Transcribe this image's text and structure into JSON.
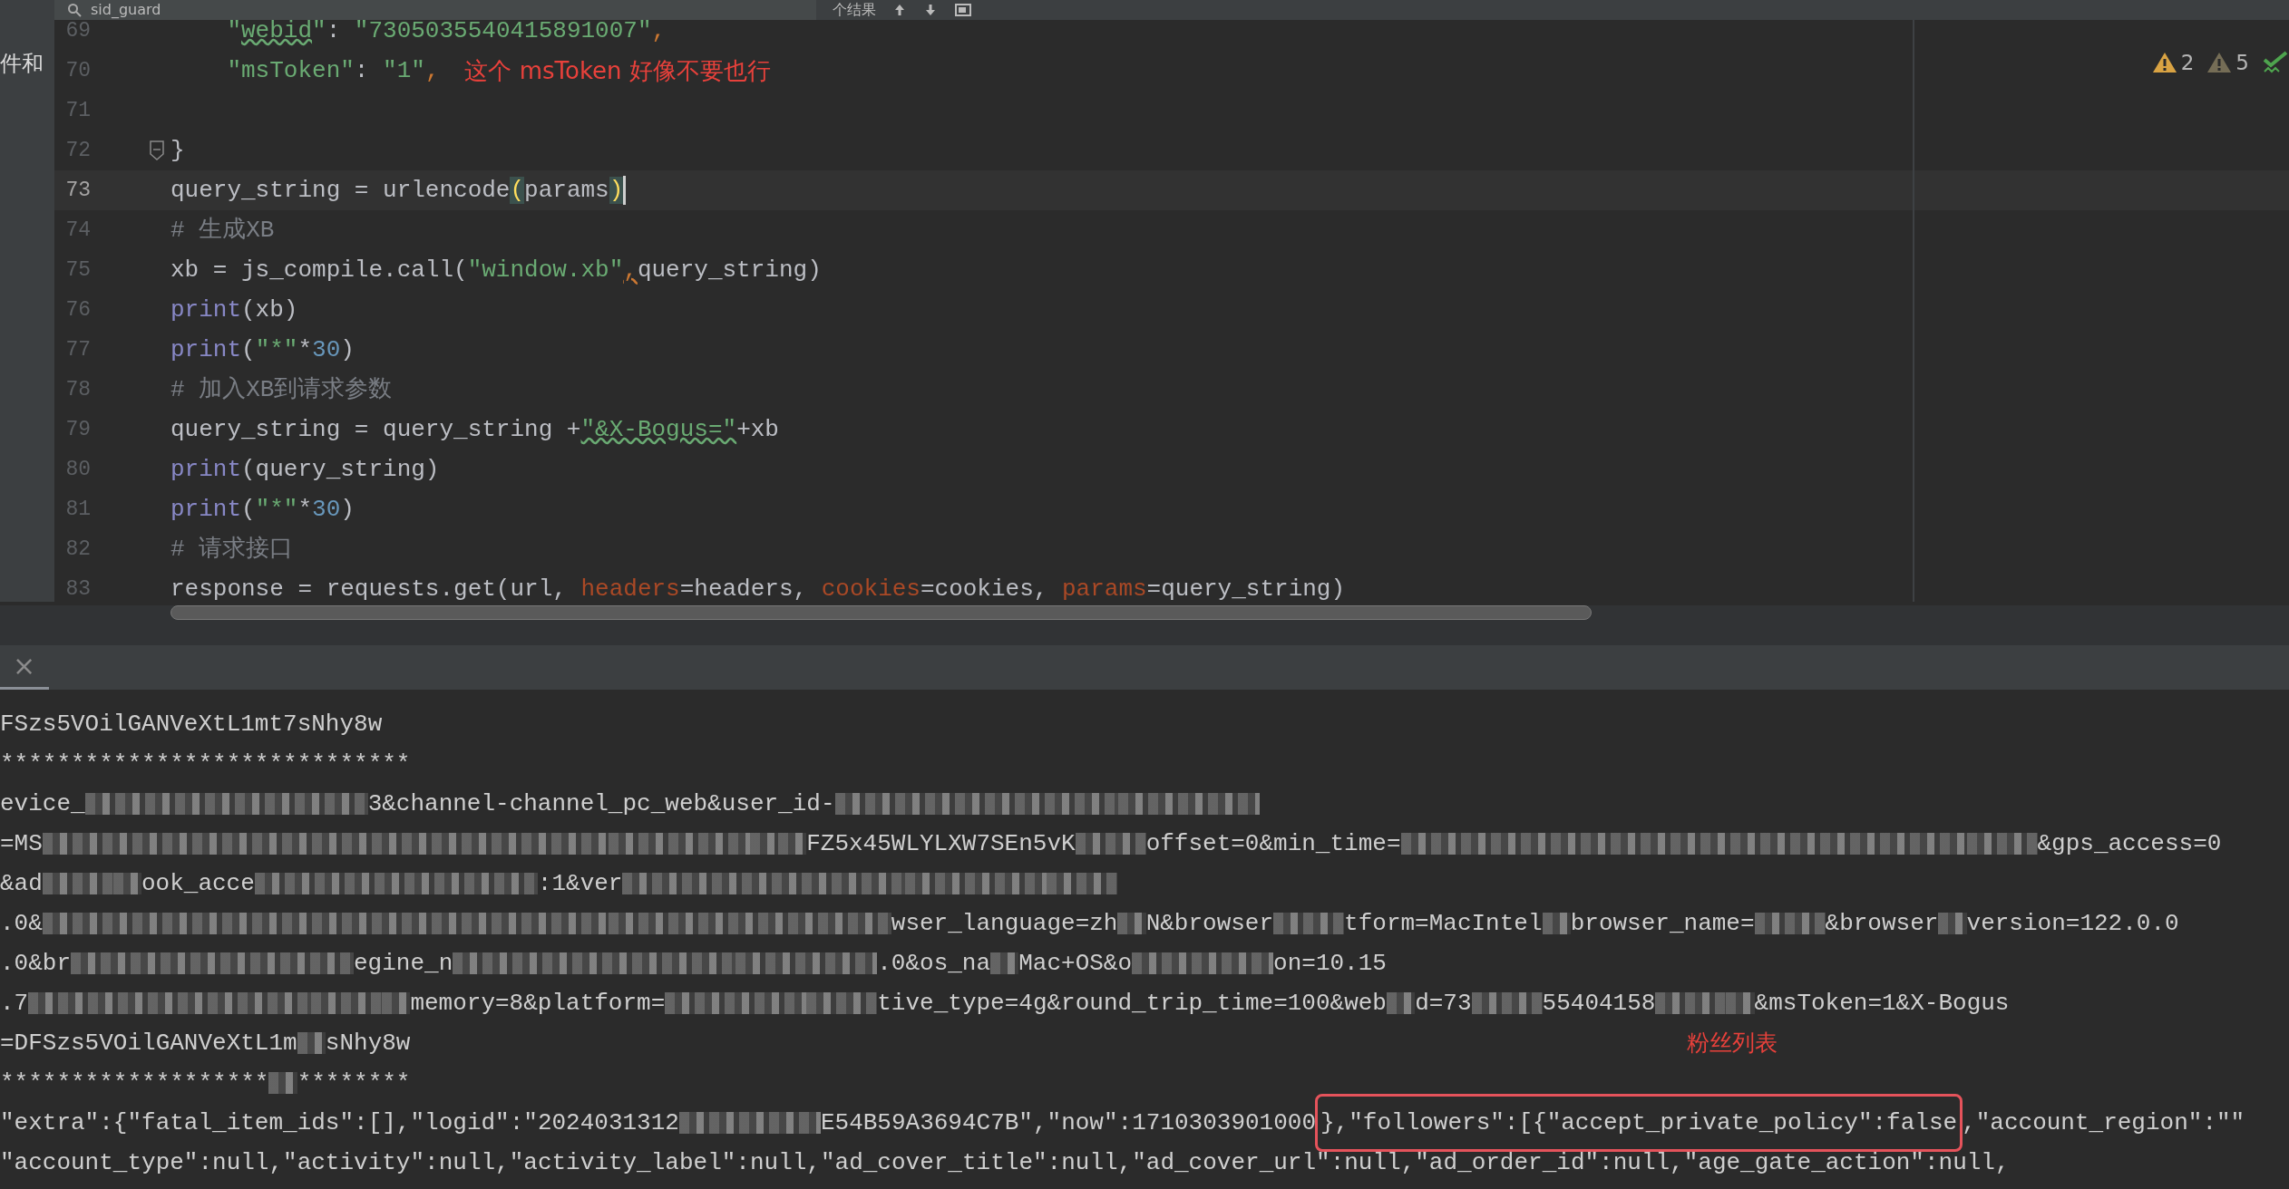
{
  "toolbar": {
    "search_text": "sid_guard",
    "results": "个结果"
  },
  "sidebar": {
    "label": "件和"
  },
  "inspections": [
    {
      "kind": "warning",
      "count": "2"
    },
    {
      "kind": "weak-warning",
      "count": "5"
    },
    {
      "kind": "ok"
    }
  ],
  "editor": {
    "lines": [
      {
        "number": "69",
        "current": false,
        "fold": false,
        "tokens": [
          {
            "t": "    \"",
            "kind": "str"
          },
          {
            "t": "webid",
            "kind": "typo"
          },
          {
            "t": "\"",
            "kind": "str"
          },
          {
            "t": ": ",
            "kind": "plain"
          },
          {
            "t": "\"7305035540415891007\"",
            "kind": "str"
          },
          {
            "t": ",",
            "kind": "punct"
          }
        ]
      },
      {
        "number": "70",
        "current": false,
        "fold": false,
        "tokens": [
          {
            "t": "    \"msToken\"",
            "kind": "str"
          },
          {
            "t": ": ",
            "kind": "plain"
          },
          {
            "t": "\"1\"",
            "kind": "str"
          },
          {
            "t": ",",
            "kind": "punct"
          }
        ],
        "note": "这个 msToken 好像不要也行"
      },
      {
        "number": "71",
        "current": false,
        "fold": false
      },
      {
        "number": "72",
        "current": false,
        "fold": true,
        "tokens": [
          {
            "t": "}",
            "kind": "plain"
          }
        ]
      },
      {
        "number": "73",
        "current": true,
        "fold": false,
        "tokens": [
          {
            "t": "query_string = urlencode",
            "kind": "plain"
          },
          {
            "t": "(",
            "kind": "match"
          },
          {
            "t": "params",
            "kind": "plain"
          },
          {
            "t": ")",
            "kind": "match"
          }
        ]
      },
      {
        "number": "74",
        "current": false,
        "fold": false,
        "tokens": [
          {
            "t": "# 生成XB",
            "kind": "comment"
          }
        ]
      },
      {
        "number": "75",
        "current": false,
        "fold": false,
        "tokens": [
          {
            "t": "xb = js_compile.call(",
            "kind": "plain"
          },
          {
            "t": "\"window.xb\"",
            "kind": "str"
          },
          {
            "t": ",",
            "kind": "warn"
          },
          {
            "t": "query_string)",
            "kind": "plain"
          }
        ]
      },
      {
        "number": "76",
        "current": false,
        "fold": false,
        "tokens": [
          {
            "t": "print",
            "kind": "builtin"
          },
          {
            "t": "(xb)",
            "kind": "plain"
          }
        ]
      },
      {
        "number": "77",
        "current": false,
        "fold": false,
        "tokens": [
          {
            "t": "print",
            "kind": "builtin"
          },
          {
            "t": "(",
            "kind": "plain"
          },
          {
            "t": "\"*\"",
            "kind": "str"
          },
          {
            "t": "*",
            "kind": "plain"
          },
          {
            "t": "30",
            "kind": "num"
          },
          {
            "t": ")",
            "kind": "plain"
          }
        ]
      },
      {
        "number": "78",
        "current": false,
        "fold": false,
        "tokens": [
          {
            "t": "# 加入XB到请求参数",
            "kind": "comment"
          }
        ]
      },
      {
        "number": "79",
        "current": false,
        "fold": false,
        "tokens": [
          {
            "t": "query_string = query_string +",
            "kind": "plain"
          },
          {
            "t": "\"&X-Bogus=\"",
            "kind": "typo"
          },
          {
            "t": "+xb",
            "kind": "plain"
          }
        ]
      },
      {
        "number": "80",
        "current": false,
        "fold": false,
        "tokens": [
          {
            "t": "print",
            "kind": "builtin"
          },
          {
            "t": "(query_string)",
            "kind": "plain"
          }
        ]
      },
      {
        "number": "81",
        "current": false,
        "fold": false,
        "tokens": [
          {
            "t": "print",
            "kind": "builtin"
          },
          {
            "t": "(",
            "kind": "plain"
          },
          {
            "t": "\"*\"",
            "kind": "str"
          },
          {
            "t": "*",
            "kind": "plain"
          },
          {
            "t": "30",
            "kind": "num"
          },
          {
            "t": ")",
            "kind": "plain"
          }
        ]
      },
      {
        "number": "82",
        "current": false,
        "fold": false,
        "tokens": [
          {
            "t": "# 请求接口",
            "kind": "comment"
          }
        ]
      },
      {
        "number": "83",
        "current": false,
        "fold": false,
        "tokens": [
          {
            "t": "response = requests.get(url, ",
            "kind": "plain"
          },
          {
            "t": "headers",
            "kind": "kwarg"
          },
          {
            "t": "=headers, ",
            "kind": "plain"
          },
          {
            "t": "cookies",
            "kind": "kwarg"
          },
          {
            "t": "=cookies, ",
            "kind": "plain"
          },
          {
            "t": "params",
            "kind": "kwarg"
          },
          {
            "t": "=query_string)",
            "kind": "plain"
          }
        ]
      }
    ]
  },
  "console": {
    "close_glyph": "×",
    "lines": [
      {
        "segments": [
          {
            "kind": "text",
            "text": "FSzs5VOilGANVeXtL1mt7sNhy8w"
          }
        ]
      },
      {
        "segments": [
          {
            "kind": "text",
            "text": "*****************************"
          }
        ]
      },
      {
        "segments": [
          {
            "kind": "text",
            "text": "evice_"
          },
          {
            "kind": "long"
          },
          {
            "kind": "text",
            "text": "3&channel-channel_pc_web&user_id-"
          },
          {
            "kind": "long"
          },
          {
            "kind": "medium"
          }
        ]
      },
      {
        "segments": [
          {
            "kind": "text",
            "text": "=MS"
          },
          {
            "kind": "wide"
          },
          {
            "kind": "medium"
          },
          {
            "kind": "tiny"
          },
          {
            "kind": "tiny"
          },
          {
            "kind": "text",
            "text": "FZ5x45WLYLXW7SEn5vK"
          },
          {
            "kind": "short"
          },
          {
            "kind": "text",
            "text": "offset=0&min_time="
          },
          {
            "kind": "wide"
          },
          {
            "kind": "short"
          },
          {
            "kind": "text",
            "text": "&gps_access=0"
          }
        ]
      },
      {
        "segments": [
          {
            "kind": "text",
            "text": "&ad"
          },
          {
            "kind": "short"
          },
          {
            "kind": "tiny"
          },
          {
            "kind": "text",
            "text": "ook_acce"
          },
          {
            "kind": "long"
          },
          {
            "kind": "text",
            "text": ":1&ver"
          },
          {
            "kind": "long"
          },
          {
            "kind": "medium"
          },
          {
            "kind": "short"
          }
        ]
      },
      {
        "segments": [
          {
            "kind": "text",
            "text": ".0&"
          },
          {
            "kind": "wide"
          },
          {
            "kind": "long"
          },
          {
            "kind": "text",
            "text": "wser_language=zh"
          },
          {
            "kind": "tiny"
          },
          {
            "kind": "text",
            "text": "N&browser"
          },
          {
            "kind": "short"
          },
          {
            "kind": "text",
            "text": "tform=MacIntel"
          },
          {
            "kind": "tiny"
          },
          {
            "kind": "text",
            "text": "browser_name="
          },
          {
            "kind": "short"
          },
          {
            "kind": "text",
            "text": "&browser"
          },
          {
            "kind": "tiny"
          },
          {
            "kind": "text",
            "text": "version=122.0.0"
          }
        ]
      },
      {
        "segments": [
          {
            "kind": "text",
            "text": ".0&br"
          },
          {
            "kind": "long"
          },
          {
            "kind": "text",
            "text": "egine_n"
          },
          {
            "kind": "long"
          },
          {
            "kind": "medium"
          },
          {
            "kind": "text",
            "text": ".0&os_na"
          },
          {
            "kind": "tiny"
          },
          {
            "kind": "text",
            "text": "Mac+OS&o"
          },
          {
            "kind": "medium"
          },
          {
            "kind": "text",
            "text": "on=10.15"
          }
        ]
      },
      {
        "segments": [
          {
            "kind": "text",
            "text": ".7"
          },
          {
            "kind": "long"
          },
          {
            "kind": "short"
          },
          {
            "kind": "tiny"
          },
          {
            "kind": "text",
            "text": "memory=8&platform="
          },
          {
            "kind": "medium"
          },
          {
            "kind": "short"
          },
          {
            "kind": "text",
            "text": "tive_type=4g&round_trip_time=100&web"
          },
          {
            "kind": "tiny"
          },
          {
            "kind": "text",
            "text": "d=73"
          },
          {
            "kind": "short"
          },
          {
            "kind": "text",
            "text": "55404158"
          },
          {
            "kind": "short"
          },
          {
            "kind": "tiny"
          },
          {
            "kind": "text",
            "text": "&msToken=1&X-Bogus"
          }
        ]
      },
      {
        "segments": [
          {
            "kind": "text",
            "text": "=DFSzs5VOilGANVeXtL1m"
          },
          {
            "kind": "tiny"
          },
          {
            "kind": "text",
            "text": "sNhy8w"
          }
        ],
        "note": "粉丝列表"
      },
      {
        "segments": [
          {
            "kind": "text",
            "text": "*******************"
          },
          {
            "kind": "tiny"
          },
          {
            "kind": "text",
            "text": "********"
          }
        ]
      },
      {
        "segments": [
          {
            "kind": "text",
            "text": "\"extra\":{\"fatal_item_ids\":[],\"logid\":\"2024031312"
          },
          {
            "kind": "medium"
          },
          {
            "kind": "text",
            "text": "E54B59A3694C7B\",\"now\":1710303901000"
          },
          {
            "kind": "boxed",
            "text": "},\"followers\":[{\"accept_private_policy\":false"
          },
          {
            "kind": "text",
            "text": ",\"account_region\":\"\""
          }
        ]
      },
      {
        "segments": [
          {
            "kind": "text",
            "text": "\"account_type\":null,\"activity\":null,\"activity_label\":null,\"ad_cover_title\":null,\"ad_cover_url\":null,\"ad_order_id\":null,\"age_gate_action\":null,"
          }
        ]
      }
    ]
  }
}
